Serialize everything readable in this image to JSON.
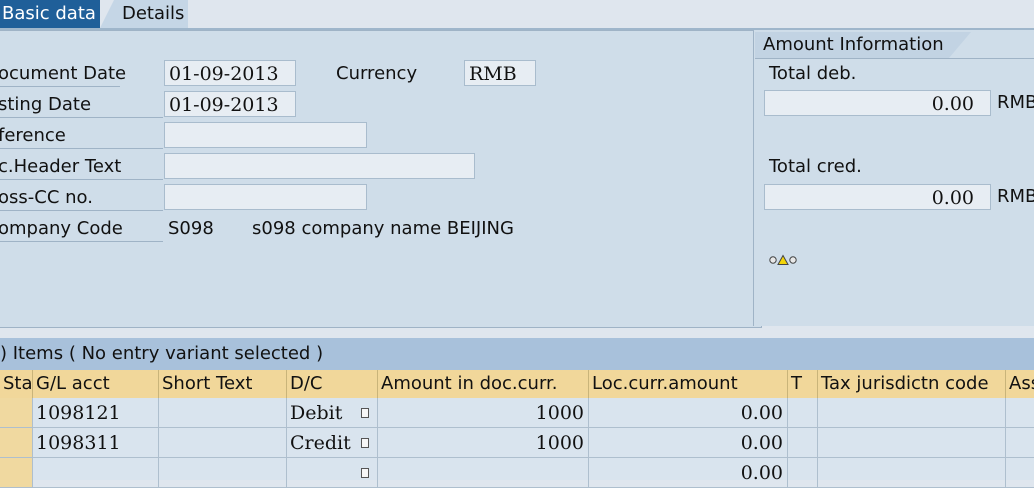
{
  "tabs": [
    {
      "label": "Basic data"
    },
    {
      "label": "Details"
    }
  ],
  "header": {
    "document_date_label": "ocument Date",
    "document_date_value": "01-09-2013",
    "currency_label": "Currency",
    "currency_value": "RMB",
    "posting_date_label": "sting Date",
    "posting_date_value": "01-09-2013",
    "reference_label": "ference",
    "reference_value": "",
    "doc_header_text_label": "c.Header Text",
    "doc_header_text_value": "",
    "cross_cc_label": "oss-CC no.",
    "cross_cc_value": "",
    "company_code_label": "ompany Code",
    "company_code_value": "S098",
    "company_name": "s098 company name BEIJING"
  },
  "amount_info": {
    "title": "Amount Information",
    "total_deb_label": "Total deb.",
    "total_deb_value": "0.00",
    "total_deb_unit": "RMB",
    "total_cred_label": "Total cred.",
    "total_cred_value": "0.00",
    "total_cred_unit": "RMB",
    "status_icon": "traffic-light-yellow"
  },
  "items": {
    "title": ") Items ( No entry variant selected )",
    "columns": [
      "Sta",
      "G/L acct",
      "Short Text",
      "D/C",
      "Amount in doc.curr.",
      "Loc.curr.amount",
      "T",
      "Tax jurisdictn code",
      "Ass"
    ],
    "rows": [
      {
        "gl_acct": "1098121",
        "short_text": "",
        "dc": "Debit",
        "amount_doc": "1000",
        "amount_loc": "0.00"
      },
      {
        "gl_acct": "1098311",
        "short_text": "",
        "dc": "Credit",
        "amount_doc": "1000",
        "amount_loc": "0.00"
      },
      {
        "gl_acct": "",
        "short_text": "",
        "dc": "",
        "amount_doc": "",
        "amount_loc": "0.00"
      }
    ]
  },
  "colors": {
    "active_tab": "#1f5f99",
    "panel_bg": "#cfdde9",
    "table_header": "#f1d79a",
    "table_title": "#a8c1db"
  }
}
